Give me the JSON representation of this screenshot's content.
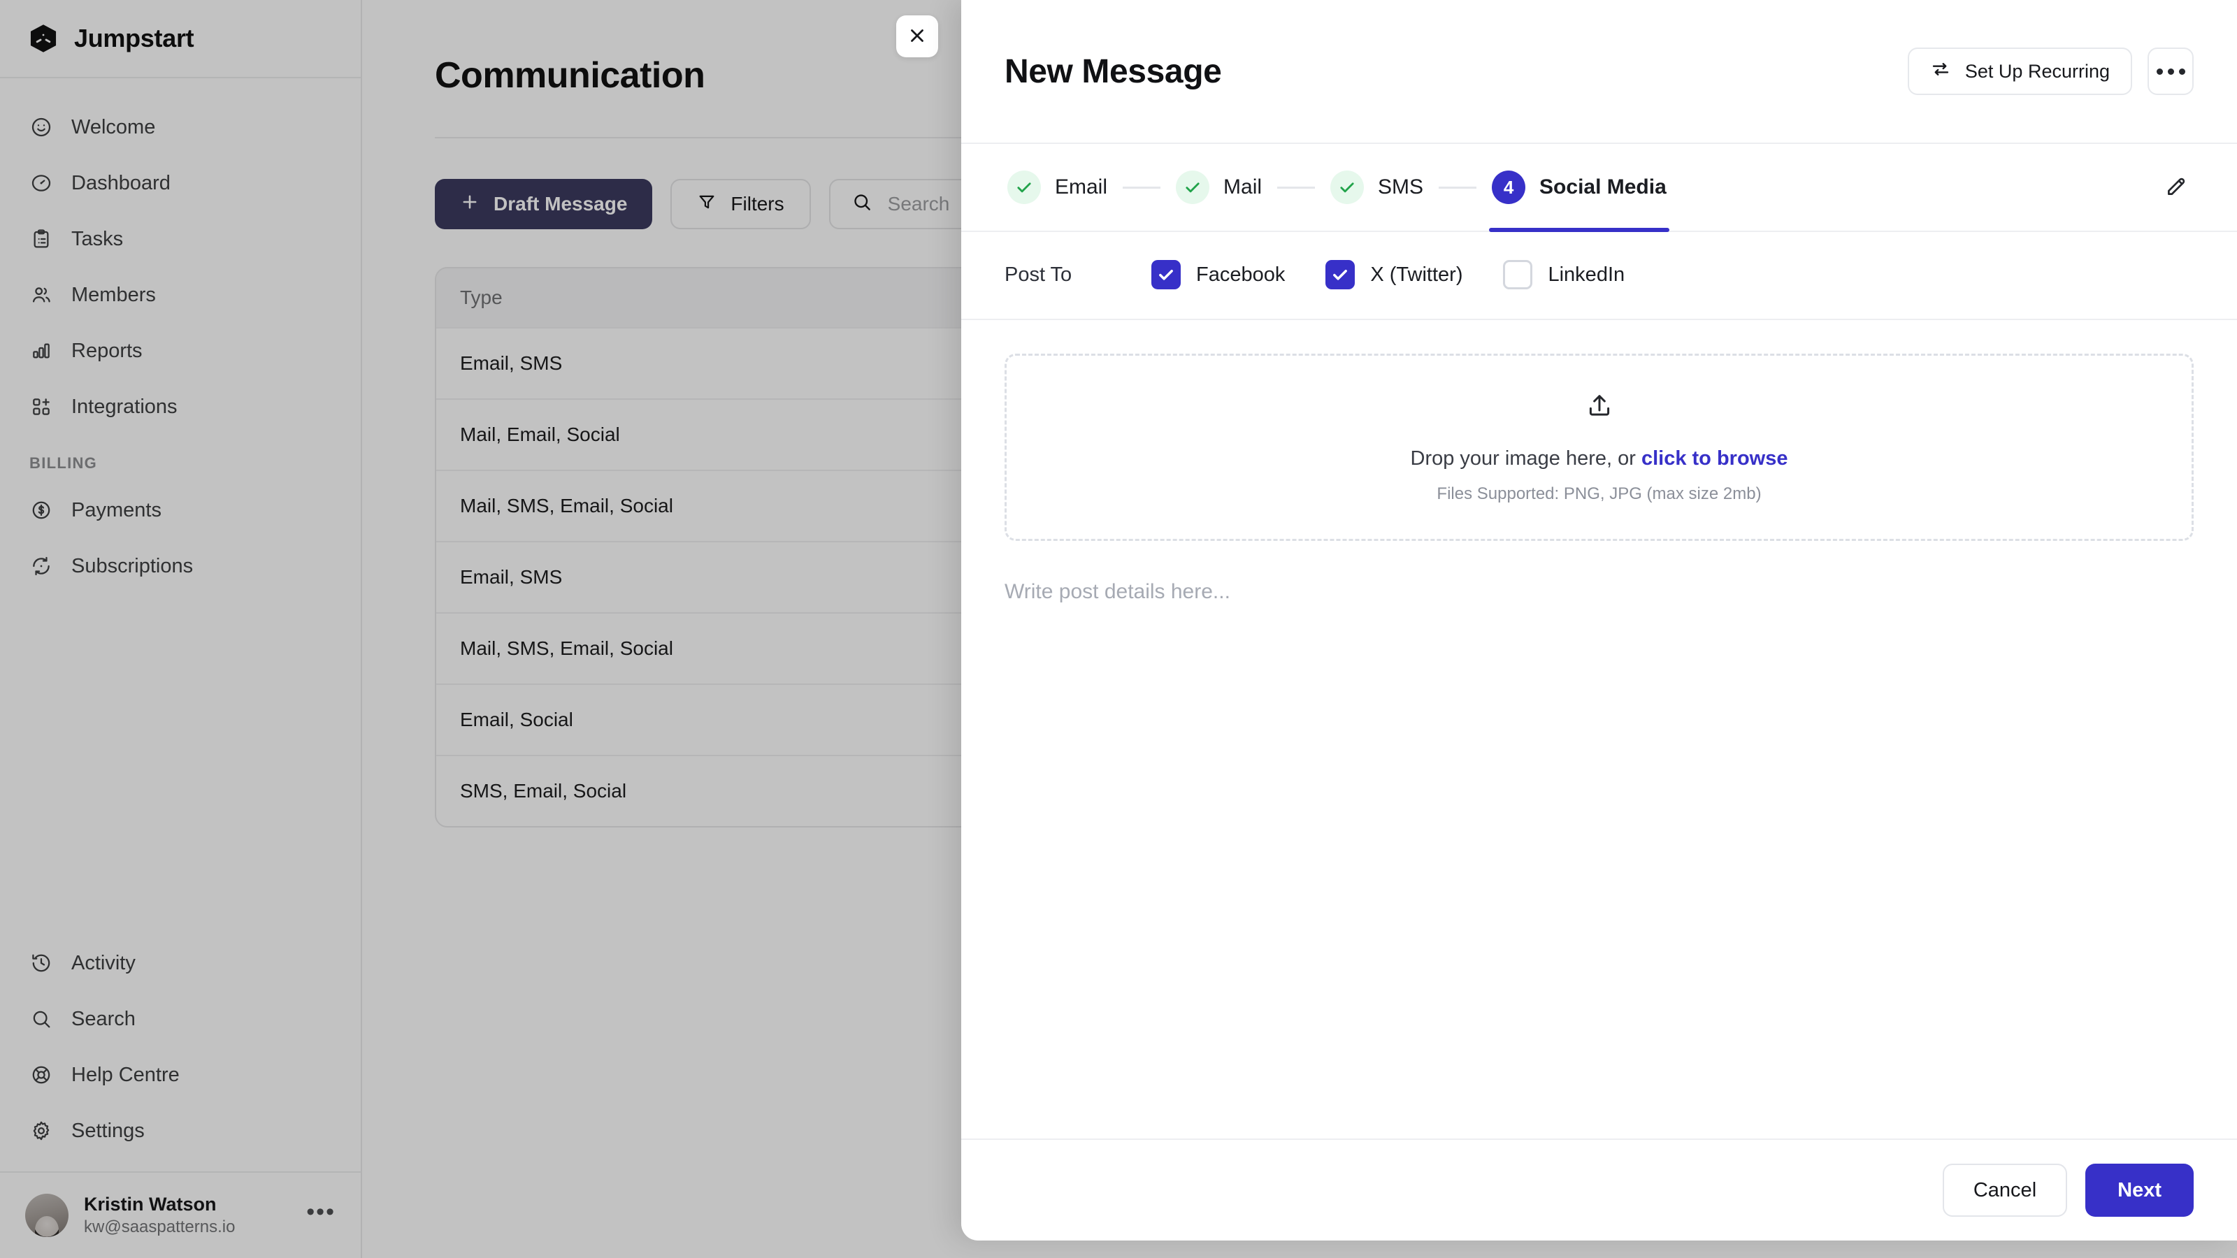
{
  "brand": {
    "name": "Jumpstart",
    "logo_icon": "cube-logo-icon"
  },
  "sidebar": {
    "items": [
      {
        "label": "Welcome",
        "icon": "smiley-icon"
      },
      {
        "label": "Dashboard",
        "icon": "gauge-icon"
      },
      {
        "label": "Tasks",
        "icon": "clipboard-icon"
      },
      {
        "label": "Members",
        "icon": "users-icon"
      },
      {
        "label": "Reports",
        "icon": "bar-chart-icon"
      },
      {
        "label": "Integrations",
        "icon": "grid-plus-icon"
      }
    ],
    "section_billing": "BILLING",
    "billing_items": [
      {
        "label": "Payments",
        "icon": "dollar-circle-icon"
      },
      {
        "label": "Subscriptions",
        "icon": "refresh-icon"
      }
    ],
    "bottom_items": [
      {
        "label": "Activity",
        "icon": "clock-history-icon"
      },
      {
        "label": "Search",
        "icon": "search-icon"
      },
      {
        "label": "Help Centre",
        "icon": "lifebuoy-icon"
      },
      {
        "label": "Settings",
        "icon": "gear-icon"
      }
    ],
    "user": {
      "name": "Kristin Watson",
      "email": "kw@saaspatterns.io",
      "menu_icon": "ellipsis-icon"
    }
  },
  "page": {
    "title": "Communication",
    "toolbar": {
      "draft_label": "Draft Message",
      "draft_icon": "plus-icon",
      "filters_label": "Filters",
      "filters_icon": "funnel-icon",
      "search_placeholder": "Search",
      "search_icon": "search-icon"
    },
    "table": {
      "columns": [
        "Type"
      ],
      "rows": [
        "Email, SMS",
        "Mail, Email, Social",
        "Mail, SMS, Email, Social",
        "Email, SMS",
        "Mail, SMS, Email, Social",
        "Email, Social",
        "SMS, Email, Social"
      ]
    }
  },
  "modal": {
    "close_icon": "close-icon",
    "title": "New Message",
    "recurring_label": "Set Up Recurring",
    "recurring_icon": "repeat-icon",
    "kebab_icon": "ellipsis-icon",
    "edit_icon": "pencil-icon",
    "steps": [
      {
        "label": "Email",
        "state": "done",
        "number": "1",
        "mark": "check-icon"
      },
      {
        "label": "Mail",
        "state": "done",
        "number": "2",
        "mark": "check-icon"
      },
      {
        "label": "SMS",
        "state": "done",
        "number": "3",
        "mark": "check-icon"
      },
      {
        "label": "Social Media",
        "state": "active",
        "number": "4",
        "mark": "4"
      }
    ],
    "post_to": {
      "label": "Post To",
      "options": [
        {
          "label": "Facebook",
          "checked": true
        },
        {
          "label": "X (Twitter)",
          "checked": true
        },
        {
          "label": "LinkedIn",
          "checked": false
        }
      ]
    },
    "dropzone": {
      "icon": "upload-icon",
      "text_before": "Drop your image here, or ",
      "link": "click to browse",
      "hint": "Files Supported: PNG, JPG (max size 2mb)"
    },
    "post_details": {
      "value": "",
      "placeholder": "Write post details here..."
    },
    "footer": {
      "cancel_label": "Cancel",
      "next_label": "Next"
    }
  },
  "colors": {
    "accent": "#3730c8",
    "success": "#21a34a",
    "success_bg": "#e6f8ec",
    "link": "#3730c8",
    "border": "#e6e8ec"
  }
}
